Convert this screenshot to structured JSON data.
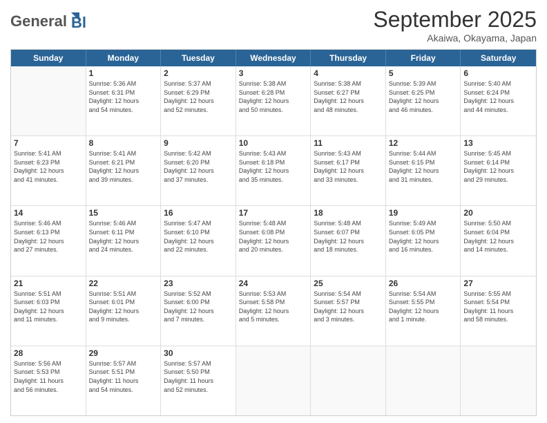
{
  "header": {
    "logo_general": "General",
    "logo_blue": "Blue",
    "month_title": "September 2025",
    "location": "Akaiwa, Okayama, Japan"
  },
  "weekdays": [
    "Sunday",
    "Monday",
    "Tuesday",
    "Wednesday",
    "Thursday",
    "Friday",
    "Saturday"
  ],
  "weeks": [
    [
      {
        "day": "",
        "lines": []
      },
      {
        "day": "1",
        "lines": [
          "Sunrise: 5:36 AM",
          "Sunset: 6:31 PM",
          "Daylight: 12 hours",
          "and 54 minutes."
        ]
      },
      {
        "day": "2",
        "lines": [
          "Sunrise: 5:37 AM",
          "Sunset: 6:29 PM",
          "Daylight: 12 hours",
          "and 52 minutes."
        ]
      },
      {
        "day": "3",
        "lines": [
          "Sunrise: 5:38 AM",
          "Sunset: 6:28 PM",
          "Daylight: 12 hours",
          "and 50 minutes."
        ]
      },
      {
        "day": "4",
        "lines": [
          "Sunrise: 5:38 AM",
          "Sunset: 6:27 PM",
          "Daylight: 12 hours",
          "and 48 minutes."
        ]
      },
      {
        "day": "5",
        "lines": [
          "Sunrise: 5:39 AM",
          "Sunset: 6:25 PM",
          "Daylight: 12 hours",
          "and 46 minutes."
        ]
      },
      {
        "day": "6",
        "lines": [
          "Sunrise: 5:40 AM",
          "Sunset: 6:24 PM",
          "Daylight: 12 hours",
          "and 44 minutes."
        ]
      }
    ],
    [
      {
        "day": "7",
        "lines": [
          "Sunrise: 5:41 AM",
          "Sunset: 6:23 PM",
          "Daylight: 12 hours",
          "and 41 minutes."
        ]
      },
      {
        "day": "8",
        "lines": [
          "Sunrise: 5:41 AM",
          "Sunset: 6:21 PM",
          "Daylight: 12 hours",
          "and 39 minutes."
        ]
      },
      {
        "day": "9",
        "lines": [
          "Sunrise: 5:42 AM",
          "Sunset: 6:20 PM",
          "Daylight: 12 hours",
          "and 37 minutes."
        ]
      },
      {
        "day": "10",
        "lines": [
          "Sunrise: 5:43 AM",
          "Sunset: 6:18 PM",
          "Daylight: 12 hours",
          "and 35 minutes."
        ]
      },
      {
        "day": "11",
        "lines": [
          "Sunrise: 5:43 AM",
          "Sunset: 6:17 PM",
          "Daylight: 12 hours",
          "and 33 minutes."
        ]
      },
      {
        "day": "12",
        "lines": [
          "Sunrise: 5:44 AM",
          "Sunset: 6:15 PM",
          "Daylight: 12 hours",
          "and 31 minutes."
        ]
      },
      {
        "day": "13",
        "lines": [
          "Sunrise: 5:45 AM",
          "Sunset: 6:14 PM",
          "Daylight: 12 hours",
          "and 29 minutes."
        ]
      }
    ],
    [
      {
        "day": "14",
        "lines": [
          "Sunrise: 5:46 AM",
          "Sunset: 6:13 PM",
          "Daylight: 12 hours",
          "and 27 minutes."
        ]
      },
      {
        "day": "15",
        "lines": [
          "Sunrise: 5:46 AM",
          "Sunset: 6:11 PM",
          "Daylight: 12 hours",
          "and 24 minutes."
        ]
      },
      {
        "day": "16",
        "lines": [
          "Sunrise: 5:47 AM",
          "Sunset: 6:10 PM",
          "Daylight: 12 hours",
          "and 22 minutes."
        ]
      },
      {
        "day": "17",
        "lines": [
          "Sunrise: 5:48 AM",
          "Sunset: 6:08 PM",
          "Daylight: 12 hours",
          "and 20 minutes."
        ]
      },
      {
        "day": "18",
        "lines": [
          "Sunrise: 5:48 AM",
          "Sunset: 6:07 PM",
          "Daylight: 12 hours",
          "and 18 minutes."
        ]
      },
      {
        "day": "19",
        "lines": [
          "Sunrise: 5:49 AM",
          "Sunset: 6:05 PM",
          "Daylight: 12 hours",
          "and 16 minutes."
        ]
      },
      {
        "day": "20",
        "lines": [
          "Sunrise: 5:50 AM",
          "Sunset: 6:04 PM",
          "Daylight: 12 hours",
          "and 14 minutes."
        ]
      }
    ],
    [
      {
        "day": "21",
        "lines": [
          "Sunrise: 5:51 AM",
          "Sunset: 6:03 PM",
          "Daylight: 12 hours",
          "and 11 minutes."
        ]
      },
      {
        "day": "22",
        "lines": [
          "Sunrise: 5:51 AM",
          "Sunset: 6:01 PM",
          "Daylight: 12 hours",
          "and 9 minutes."
        ]
      },
      {
        "day": "23",
        "lines": [
          "Sunrise: 5:52 AM",
          "Sunset: 6:00 PM",
          "Daylight: 12 hours",
          "and 7 minutes."
        ]
      },
      {
        "day": "24",
        "lines": [
          "Sunrise: 5:53 AM",
          "Sunset: 5:58 PM",
          "Daylight: 12 hours",
          "and 5 minutes."
        ]
      },
      {
        "day": "25",
        "lines": [
          "Sunrise: 5:54 AM",
          "Sunset: 5:57 PM",
          "Daylight: 12 hours",
          "and 3 minutes."
        ]
      },
      {
        "day": "26",
        "lines": [
          "Sunrise: 5:54 AM",
          "Sunset: 5:55 PM",
          "Daylight: 12 hours",
          "and 1 minute."
        ]
      },
      {
        "day": "27",
        "lines": [
          "Sunrise: 5:55 AM",
          "Sunset: 5:54 PM",
          "Daylight: 11 hours",
          "and 58 minutes."
        ]
      }
    ],
    [
      {
        "day": "28",
        "lines": [
          "Sunrise: 5:56 AM",
          "Sunset: 5:53 PM",
          "Daylight: 11 hours",
          "and 56 minutes."
        ]
      },
      {
        "day": "29",
        "lines": [
          "Sunrise: 5:57 AM",
          "Sunset: 5:51 PM",
          "Daylight: 11 hours",
          "and 54 minutes."
        ]
      },
      {
        "day": "30",
        "lines": [
          "Sunrise: 5:57 AM",
          "Sunset: 5:50 PM",
          "Daylight: 11 hours",
          "and 52 minutes."
        ]
      },
      {
        "day": "",
        "lines": []
      },
      {
        "day": "",
        "lines": []
      },
      {
        "day": "",
        "lines": []
      },
      {
        "day": "",
        "lines": []
      }
    ]
  ]
}
